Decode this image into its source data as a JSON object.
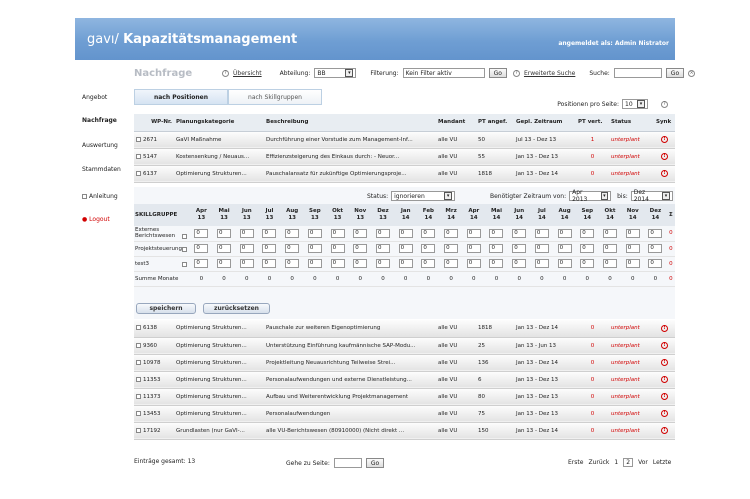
{
  "app": {
    "logo_small": "gavı",
    "logo_sep": "/",
    "logo_title": "Kapazitätsmanagement",
    "user_label": "angemeldet als: Admin Nistrator"
  },
  "page": {
    "title": "Nachfrage"
  },
  "toolbar": {
    "overview_link": "Übersicht",
    "dept_label": "Abteilung:",
    "dept_value": "BB",
    "filter_label": "Filterung:",
    "filter_value": "Kein Filter aktiv",
    "go": "Go",
    "adv_search": "Erweiterte Suche",
    "search_label": "Suche:",
    "search_value": ""
  },
  "sidebar": {
    "items": [
      "Angebot",
      "Nachfrage",
      "Auswertung",
      "Stammdaten",
      "Anleitung",
      "Logout"
    ]
  },
  "tabs": [
    {
      "label": "nach Positionen"
    },
    {
      "label": "nach Skillgruppen"
    }
  ],
  "pps": {
    "label": "Positionen pro Seite:",
    "value": "10"
  },
  "columns": [
    "WP-Nr.",
    "Planungskategorie",
    "Beschreibung",
    "Mandant",
    "PT angef.",
    "Gepl. Zeitraum",
    "PT vert.",
    "Status",
    "Synk"
  ],
  "rows_top": [
    {
      "wp": "2671",
      "kat": "GaVI Maßnahme",
      "desc": "Durchführung einer Vorstudie zum Management-Inf...",
      "mandant": "alle VU",
      "pt": "50",
      "zeit": "Jul 13 - Dez 13",
      "ptv": "1",
      "status": "unterplant"
    },
    {
      "wp": "5147",
      "kat": "Kostensenkung / Neuaus...",
      "desc": "Effizienzsteigerung des Einkaus durch: - Neuor...",
      "mandant": "alle VU",
      "pt": "55",
      "zeit": "Jan 13 - Dez 13",
      "ptv": "0",
      "status": "unterplant"
    },
    {
      "wp": "6137",
      "kat": "Optimierung Strukturen...",
      "desc": "Pauschalansatz für zukünftige Optimierungsproje...",
      "mandant": "alle VU",
      "pt": "1818",
      "zeit": "Jan 13 - Dez 14",
      "ptv": "0",
      "status": "unterplant"
    }
  ],
  "panel": {
    "status_label": "Status:",
    "status_value": "ignorieren",
    "zeitraum_label": "Benötigter Zeitraum von:",
    "from_value": "Apr 2013",
    "bis_label": "bis:",
    "to_value": "Dez 2014",
    "skill_header": "SKILLGRUPPE",
    "sigma": "Σ",
    "save": "speichern",
    "reset": "zurücksetzen"
  },
  "months": [
    [
      "Apr",
      "13"
    ],
    [
      "Mai",
      "13"
    ],
    [
      "Jun",
      "13"
    ],
    [
      "Jul",
      "13"
    ],
    [
      "Aug",
      "13"
    ],
    [
      "Sep",
      "13"
    ],
    [
      "Okt",
      "13"
    ],
    [
      "Nov",
      "13"
    ],
    [
      "Dez",
      "13"
    ],
    [
      "Jan",
      "14"
    ],
    [
      "Feb",
      "14"
    ],
    [
      "Mrz",
      "14"
    ],
    [
      "Apr",
      "14"
    ],
    [
      "Mai",
      "14"
    ],
    [
      "Jun",
      "14"
    ],
    [
      "Jul",
      "14"
    ],
    [
      "Aug",
      "14"
    ],
    [
      "Sep",
      "14"
    ],
    [
      "Okt",
      "14"
    ],
    [
      "Nov",
      "14"
    ],
    [
      "Dez",
      "14"
    ]
  ],
  "skills": [
    {
      "name": "Externes Berichtswesen",
      "values": [
        "0",
        "0",
        "0",
        "0",
        "0",
        "0",
        "0",
        "0",
        "0",
        "0",
        "0",
        "0",
        "0",
        "0",
        "0",
        "0",
        "0",
        "0",
        "0",
        "0",
        "0"
      ],
      "sum": "0"
    },
    {
      "name": "Projektsteuerung",
      "values": [
        "0",
        "0",
        "0",
        "0",
        "0",
        "0",
        "0",
        "0",
        "0",
        "0",
        "0",
        "0",
        "0",
        "0",
        "0",
        "0",
        "0",
        "0",
        "0",
        "0",
        "0"
      ],
      "sum": "0"
    },
    {
      "name": "test3",
      "values": [
        "0",
        "0",
        "0",
        "0",
        "0",
        "0",
        "0",
        "0",
        "0",
        "0",
        "0",
        "0",
        "0",
        "0",
        "0",
        "0",
        "0",
        "0",
        "0",
        "0",
        "0"
      ],
      "sum": "0"
    }
  ],
  "summe": {
    "label": "Summe Monate",
    "values": [
      "0",
      "0",
      "0",
      "0",
      "0",
      "0",
      "0",
      "0",
      "0",
      "0",
      "0",
      "0",
      "0",
      "0",
      "0",
      "0",
      "0",
      "0",
      "0",
      "0",
      "0"
    ],
    "sum": "0"
  },
  "rows_bottom": [
    {
      "wp": "6138",
      "kat": "Optimierung Strukturen...",
      "desc": "Pauschale zur weiteren Eigenoptimierung",
      "mandant": "alle VU",
      "pt": "1818",
      "zeit": "Jan 13 - Dez 14",
      "ptv": "0",
      "status": "unterplant"
    },
    {
      "wp": "9360",
      "kat": "Optimierung Strukturen...",
      "desc": "Unterstützung Einführung kaufmännische SAP-Modu...",
      "mandant": "alle VU",
      "pt": "25",
      "zeit": "Jan 13 - Jun 13",
      "ptv": "0",
      "status": "unterplant"
    },
    {
      "wp": "10978",
      "kat": "Optimierung Strukturen...",
      "desc": "Projektleitung Neuausrichtung Teilweise Strei...",
      "mandant": "alle VU",
      "pt": "136",
      "zeit": "Jan 13 - Dez 14",
      "ptv": "0",
      "status": "unterplant"
    },
    {
      "wp": "11353",
      "kat": "Optimierung Strukturen...",
      "desc": "Personalaufwendungen und externe Dienstleistung...",
      "mandant": "alle VU",
      "pt": "6",
      "zeit": "Jan 13 - Dez 13",
      "ptv": "0",
      "status": "unterplant"
    },
    {
      "wp": "11373",
      "kat": "Optimierung Strukturen...",
      "desc": "Aufbau und Weiterentwicklung Projektmanagement",
      "mandant": "alle VU",
      "pt": "80",
      "zeit": "Jan 13 - Dez 13",
      "ptv": "0",
      "status": "unterplant"
    },
    {
      "wp": "13453",
      "kat": "Optimierung Strukturen...",
      "desc": "Personalaufwendungen",
      "mandant": "alle VU",
      "pt": "75",
      "zeit": "Jan 13 - Dez 13",
      "ptv": "0",
      "status": "unterplant"
    },
    {
      "wp": "17192",
      "kat": "Grundlasten (nur GaVI-...",
      "desc": "alle VU-Berichtswesen (80910000) (Nicht direkt ...",
      "mandant": "alle VU",
      "pt": "150",
      "zeit": "Jan 13 - Dez 14",
      "ptv": "0",
      "status": "unterplant"
    }
  ],
  "footer": {
    "total": "Einträge gesamt: 13",
    "goto_label": "Gehe zu Seite:",
    "go": "Go",
    "first": "Erste",
    "prev": "Zurück",
    "p1": "1",
    "p2": "2",
    "next": "Vor",
    "last": "Letzte"
  },
  "colors": {
    "banner": "#6f9ed3",
    "status": "#d10000"
  },
  "icons": {
    "overview": "help-circle-icon",
    "synk": "warning-icon",
    "close": "close-circle-icon"
  }
}
